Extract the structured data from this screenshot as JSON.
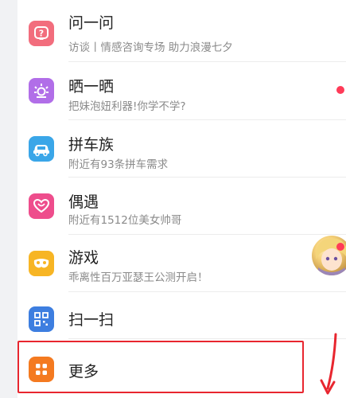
{
  "items": [
    {
      "title": "问一问",
      "subtitle": "访谈丨情感咨询专场 助力浪漫七夕",
      "icon": "question-icon",
      "color": "#f26d7d"
    },
    {
      "title": "晒一晒",
      "subtitle": "把妹泡妞利器!你学不学?",
      "icon": "sun-icon",
      "color": "#b16ee8"
    },
    {
      "title": "拼车族",
      "subtitle": "附近有93条拼车需求",
      "icon": "car-icon",
      "color": "#3aa6e8"
    },
    {
      "title": "偶遇",
      "subtitle": "附近有1512位美女帅哥",
      "icon": "heart-icon",
      "color": "#ee4d8c"
    },
    {
      "title": "游戏",
      "subtitle": "乖离性百万亚瑟王公测开启！",
      "icon": "game-mask-icon",
      "color": "#f7b524"
    },
    {
      "title": "扫一扫",
      "subtitle": "",
      "icon": "qr-scan-icon",
      "color": "#3d7ee0"
    },
    {
      "title": "更多",
      "subtitle": "",
      "icon": "more-grid-icon",
      "color": "#f47a20"
    }
  ],
  "colors": {
    "highlight": "#e8262f",
    "badge": "#ff3b58"
  }
}
